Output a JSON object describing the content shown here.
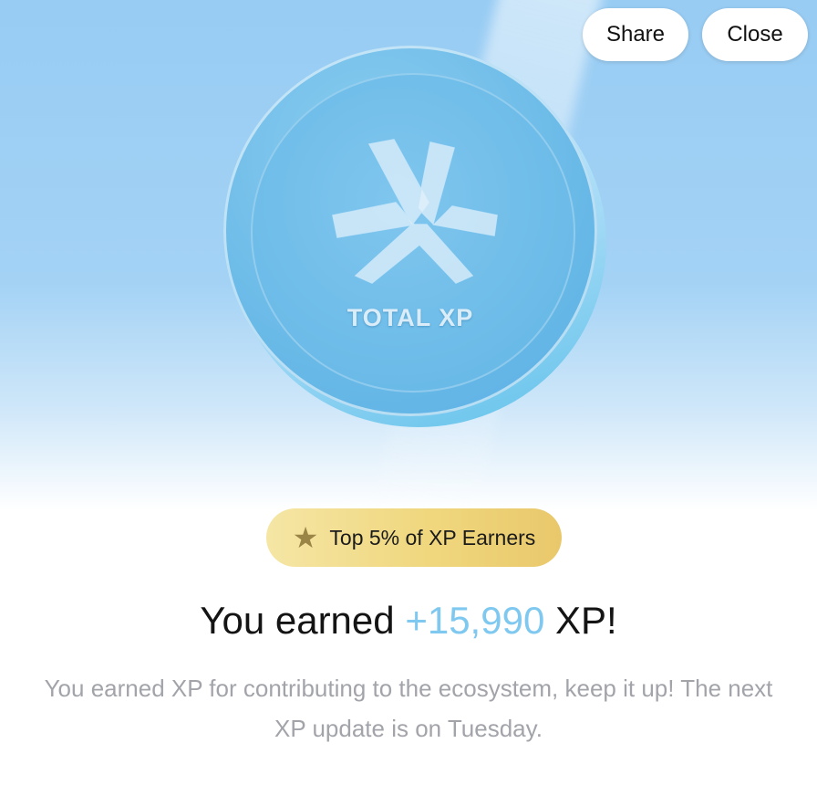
{
  "header": {
    "share_label": "Share",
    "close_label": "Close"
  },
  "coin": {
    "label": "TOTAL XP",
    "logo_icon": "xp-tri-chevron-logo"
  },
  "badge": {
    "icon": "star-icon",
    "text": "Top 5% of XP Earners"
  },
  "headline": {
    "prefix": "You earned",
    "amount": "+15,990",
    "suffix": "XP!"
  },
  "description": "You earned XP for contributing to the ecosystem, keep it up! The next XP update is on Tuesday.",
  "colors": {
    "accent": "#7fc8f0",
    "badge_gold": "#f0d77e",
    "hero_blue": "#98ccf3"
  }
}
